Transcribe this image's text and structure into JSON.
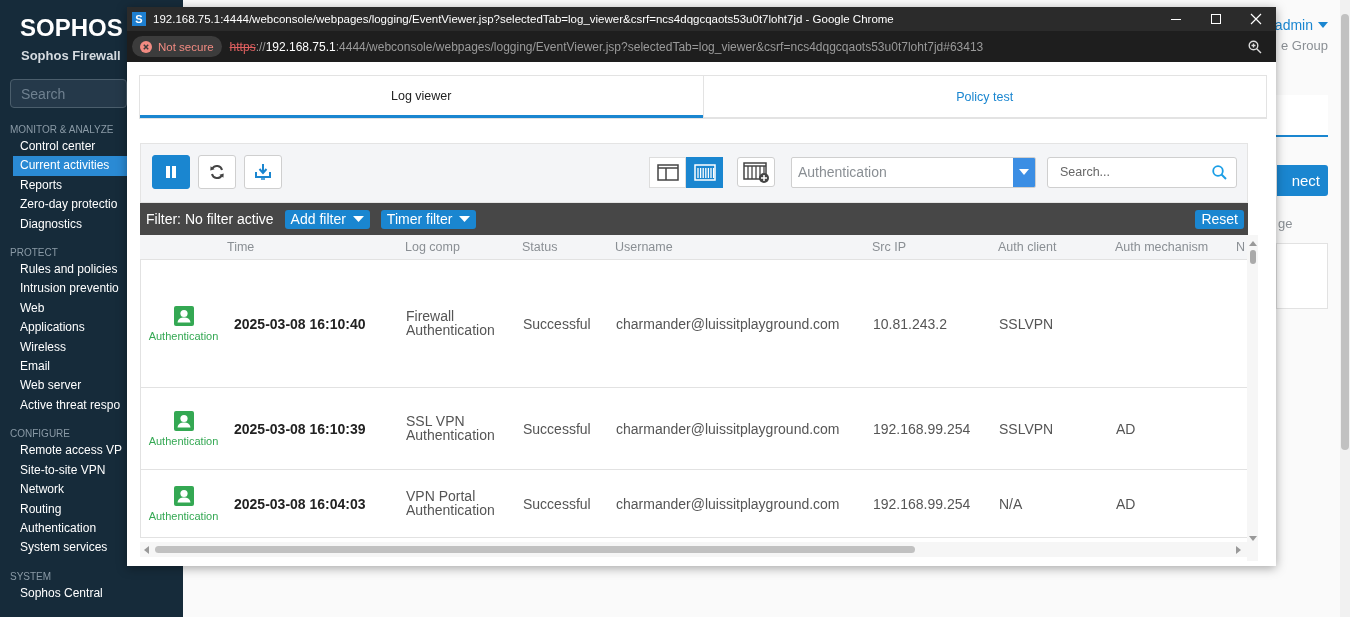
{
  "sidebar": {
    "logo": "SOPHOS",
    "product": "Sophos Firewall",
    "search": {
      "placeholder": "Search"
    },
    "sections": [
      {
        "heading": "MONITOR & ANALYZE",
        "items": [
          {
            "label": "Control center",
            "selected": false
          },
          {
            "label": "Current activities",
            "selected": true
          },
          {
            "label": "Reports",
            "selected": false
          },
          {
            "label": "Zero-day protectio",
            "selected": false
          },
          {
            "label": "Diagnostics",
            "selected": false
          }
        ]
      },
      {
        "heading": "PROTECT",
        "items": [
          {
            "label": "Rules and policies",
            "selected": false
          },
          {
            "label": "Intrusion preventio",
            "selected": false
          },
          {
            "label": "Web",
            "selected": false
          },
          {
            "label": "Applications",
            "selected": false
          },
          {
            "label": "Wireless",
            "selected": false
          },
          {
            "label": "Email",
            "selected": false
          },
          {
            "label": "Web server",
            "selected": false
          },
          {
            "label": "Active threat respo",
            "selected": false
          }
        ]
      },
      {
        "heading": "CONFIGURE",
        "items": [
          {
            "label": "Remote access VP",
            "selected": false
          },
          {
            "label": "Site-to-site VPN",
            "selected": false
          },
          {
            "label": "Network",
            "selected": false
          },
          {
            "label": "Routing",
            "selected": false
          },
          {
            "label": "Authentication",
            "selected": false
          },
          {
            "label": "System services",
            "selected": false
          }
        ]
      },
      {
        "heading": "SYSTEM",
        "items": [
          {
            "label": "Sophos Central",
            "selected": false
          }
        ]
      }
    ]
  },
  "background_page": {
    "user": "admin",
    "group": "e Group",
    "button": "nect",
    "text": "ge"
  },
  "browser_window": {
    "favicon": "S",
    "title": "192.168.75.1:4444/webconsole/webpages/logging/EventViewer.jsp?selectedTab=log_viewer&csrf=ncs4dqgcqaots53u0t7loht7jd - Google Chrome",
    "security": "Not secure",
    "url": {
      "scheme": "https",
      "separator": "://",
      "host": "192.168.75.1",
      "rest": ":4444/webconsole/webpages/logging/EventViewer.jsp?selectedTab=log_viewer&csrf=ncs4dqgcqaots53u0t7loht7jd#63413"
    }
  },
  "tabs": [
    {
      "label": "Log viewer",
      "selected": true
    },
    {
      "label": "Policy test",
      "selected": false
    }
  ],
  "toolbar": {
    "buttons": [
      {
        "kind": "pause",
        "active": true
      },
      {
        "kind": "refresh",
        "active": false
      },
      {
        "kind": "download",
        "active": false
      }
    ],
    "views": [
      {
        "kind": "panes",
        "selected": false
      },
      {
        "kind": "columns",
        "selected": true
      }
    ],
    "log_type": {
      "value": "Authentication"
    },
    "search": {
      "placeholder": "Search..."
    }
  },
  "filter_bar": {
    "label": "Filter: No filter active",
    "buttons": [
      "Add filter",
      "Timer filter"
    ],
    "reset": "Reset"
  },
  "table": {
    "columns": [
      "Time",
      "Log comp",
      "Status",
      "Username",
      "Src IP",
      "Auth client",
      "Auth mechanism",
      "N"
    ],
    "rows": [
      {
        "type": "Authentication",
        "cells": [
          "2025-03-08 16:10:40",
          "Firewall Authentication",
          "Successful",
          "charmander@luissitplayground.com",
          "10.81.243.2",
          "SSLVPN",
          ""
        ]
      },
      {
        "type": "Authentication",
        "cells": [
          "2025-03-08 16:10:39",
          "SSL VPN Authentication",
          "Successful",
          "charmander@luissitplayground.com",
          "192.168.99.254",
          "SSLVPN",
          "AD"
        ]
      },
      {
        "type": "Authentication",
        "cells": [
          "2025-03-08 16:04:03",
          "VPN Portal Authentication",
          "Successful",
          "charmander@luissitplayground.com",
          "192.168.99.254",
          "N/A",
          "AD"
        ]
      }
    ]
  }
}
